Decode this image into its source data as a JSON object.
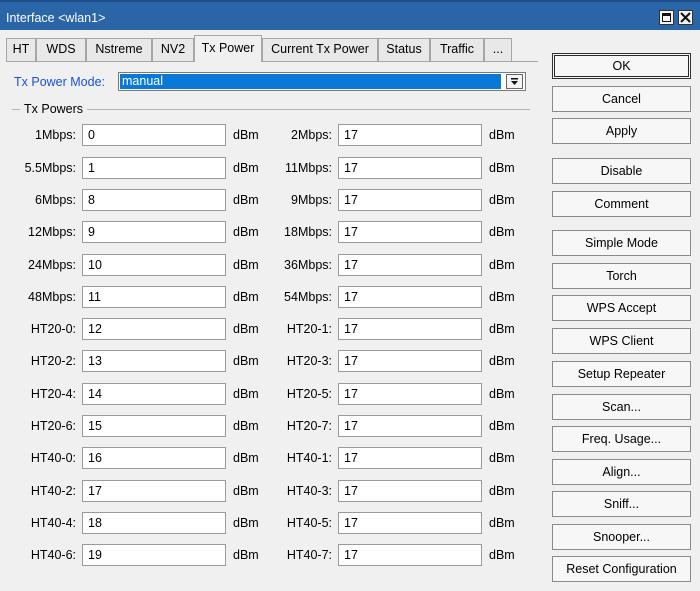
{
  "window": {
    "title": "Interface <wlan1>"
  },
  "tabs": [
    {
      "label": "HT"
    },
    {
      "label": "WDS"
    },
    {
      "label": "Nstreme"
    },
    {
      "label": "NV2"
    },
    {
      "label": "Tx Power",
      "active": true
    },
    {
      "label": "Current Tx Power"
    },
    {
      "label": "Status"
    },
    {
      "label": "Traffic"
    },
    {
      "label": "..."
    }
  ],
  "tx_power_mode": {
    "label": "Tx Power Mode:",
    "value": "manual"
  },
  "group": {
    "label": "Tx Powers"
  },
  "unit": "dBm",
  "powers": [
    {
      "label": "1Mbps:",
      "value": "0"
    },
    {
      "label": "2Mbps:",
      "value": "17"
    },
    {
      "label": "5.5Mbps:",
      "value": "1"
    },
    {
      "label": "11Mbps:",
      "value": "17"
    },
    {
      "label": "6Mbps:",
      "value": "8"
    },
    {
      "label": "9Mbps:",
      "value": "17"
    },
    {
      "label": "12Mbps:",
      "value": "9"
    },
    {
      "label": "18Mbps:",
      "value": "17"
    },
    {
      "label": "24Mbps:",
      "value": "10"
    },
    {
      "label": "36Mbps:",
      "value": "17"
    },
    {
      "label": "48Mbps:",
      "value": "11"
    },
    {
      "label": "54Mbps:",
      "value": "17"
    },
    {
      "label": "HT20-0:",
      "value": "12"
    },
    {
      "label": "HT20-1:",
      "value": "17"
    },
    {
      "label": "HT20-2:",
      "value": "13"
    },
    {
      "label": "HT20-3:",
      "value": "17"
    },
    {
      "label": "HT20-4:",
      "value": "14"
    },
    {
      "label": "HT20-5:",
      "value": "17"
    },
    {
      "label": "HT20-6:",
      "value": "15"
    },
    {
      "label": "HT20-7:",
      "value": "17"
    },
    {
      "label": "HT40-0:",
      "value": "16"
    },
    {
      "label": "HT40-1:",
      "value": "17"
    },
    {
      "label": "HT40-2:",
      "value": "17"
    },
    {
      "label": "HT40-3:",
      "value": "17"
    },
    {
      "label": "HT40-4:",
      "value": "18"
    },
    {
      "label": "HT40-5:",
      "value": "17"
    },
    {
      "label": "HT40-6:",
      "value": "19"
    },
    {
      "label": "HT40-7:",
      "value": "17"
    }
  ],
  "buttons": [
    {
      "label": "OK"
    },
    {
      "label": "Cancel"
    },
    {
      "label": "Apply"
    },
    {
      "label": "Disable"
    },
    {
      "label": "Comment"
    },
    {
      "label": "Simple Mode"
    },
    {
      "label": "Torch"
    },
    {
      "label": "WPS Accept"
    },
    {
      "label": "WPS Client"
    },
    {
      "label": "Setup Repeater"
    },
    {
      "label": "Scan..."
    },
    {
      "label": "Freq. Usage..."
    },
    {
      "label": "Align..."
    },
    {
      "label": "Sniff..."
    },
    {
      "label": "Snooper..."
    },
    {
      "label": "Reset Configuration"
    }
  ],
  "colors": {
    "titlebar": "#2a65a8",
    "accent_label": "#1a4fd8",
    "selection": "#0a78d7"
  },
  "icons": [
    "maximize-icon",
    "close-icon",
    "dropdown-arrow-icon"
  ]
}
